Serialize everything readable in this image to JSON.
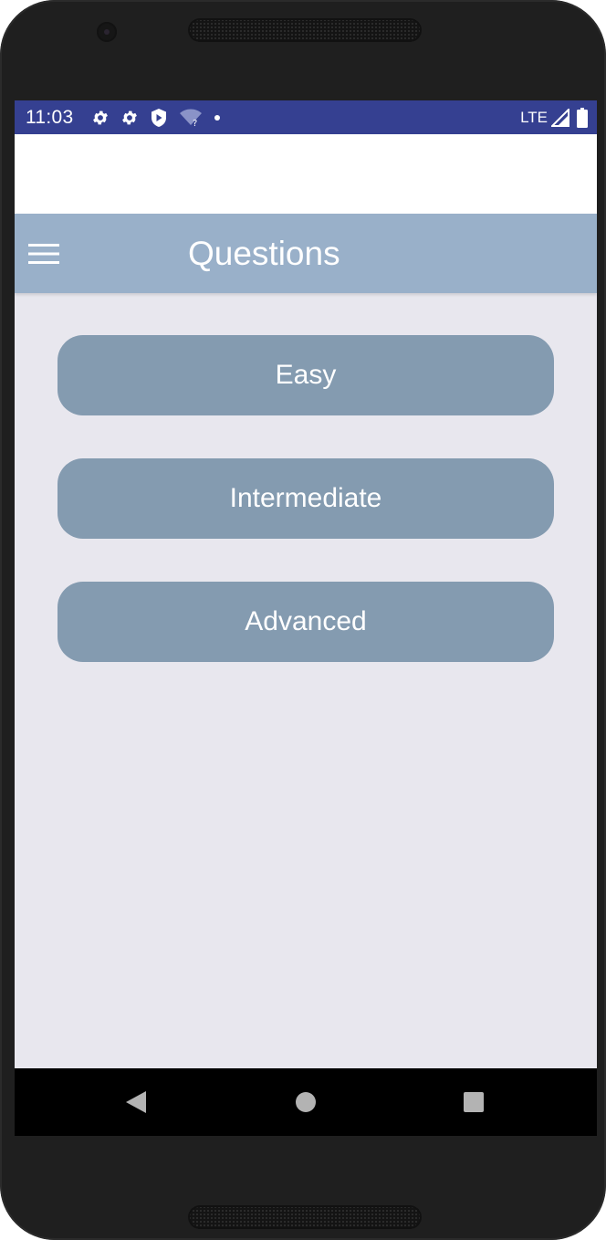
{
  "status_bar": {
    "time": "11:03",
    "network_label": "LTE",
    "icons": [
      "settings-icon",
      "settings-icon",
      "shield-icon",
      "wifi-unknown-icon",
      "notification-dot-icon",
      "cellular-signal-icon",
      "battery-icon"
    ],
    "background_color": "#354091"
  },
  "app_bar": {
    "title": "Questions",
    "menu_icon": "hamburger-menu-icon",
    "background_color": "#99b0c9"
  },
  "difficulty_buttons": [
    {
      "label": "Easy"
    },
    {
      "label": "Intermediate"
    },
    {
      "label": "Advanced"
    }
  ],
  "button_color": "#849bb0",
  "content_background": "#e8e7ee",
  "navigation_bar": {
    "icons": [
      "back-triangle-icon",
      "home-circle-icon",
      "recents-square-icon"
    ]
  }
}
